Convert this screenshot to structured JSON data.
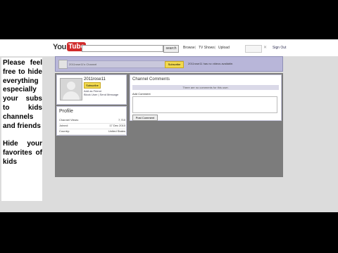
{
  "topbar": {
    "logo_you": "You",
    "logo_tube": "Tube",
    "search_button": "search",
    "nav": [
      "Browse",
      "TV Shows",
      "Upload"
    ],
    "signout": "Sign Out"
  },
  "note": {
    "paragraph1": "Please feel free to hide everything especially your subs to kids channels and friends",
    "paragraph2": "Hide your favorites of kids"
  },
  "channel_header": {
    "chip_text": "2011rose11's Channel",
    "subscribe_label": "Subscribe",
    "status_text": "2011rose11 has no videos available."
  },
  "profile_card": {
    "username": "2011rose11",
    "subscribe_label": "Subscribe",
    "add_friend": "Add as Friend",
    "block_user": "Block User | Send Message"
  },
  "profile": {
    "title": "Profile",
    "rows": [
      {
        "label": "Channel Views:",
        "value": "7,710"
      },
      {
        "label": "Joined:",
        "value": "17 Dec 2010"
      },
      {
        "label": "Country:",
        "value": "United States"
      }
    ]
  },
  "comments": {
    "title": "Channel Comments",
    "empty_text": "There are no comments for this user.",
    "add_label": "Add Comment",
    "post_button": "Post Comment"
  },
  "colors": {
    "header_bg": "#b8b6d9",
    "subscribe": "#f2d94e",
    "logo_red": "#d12b2b",
    "content_bg": "#7c7c7c"
  }
}
